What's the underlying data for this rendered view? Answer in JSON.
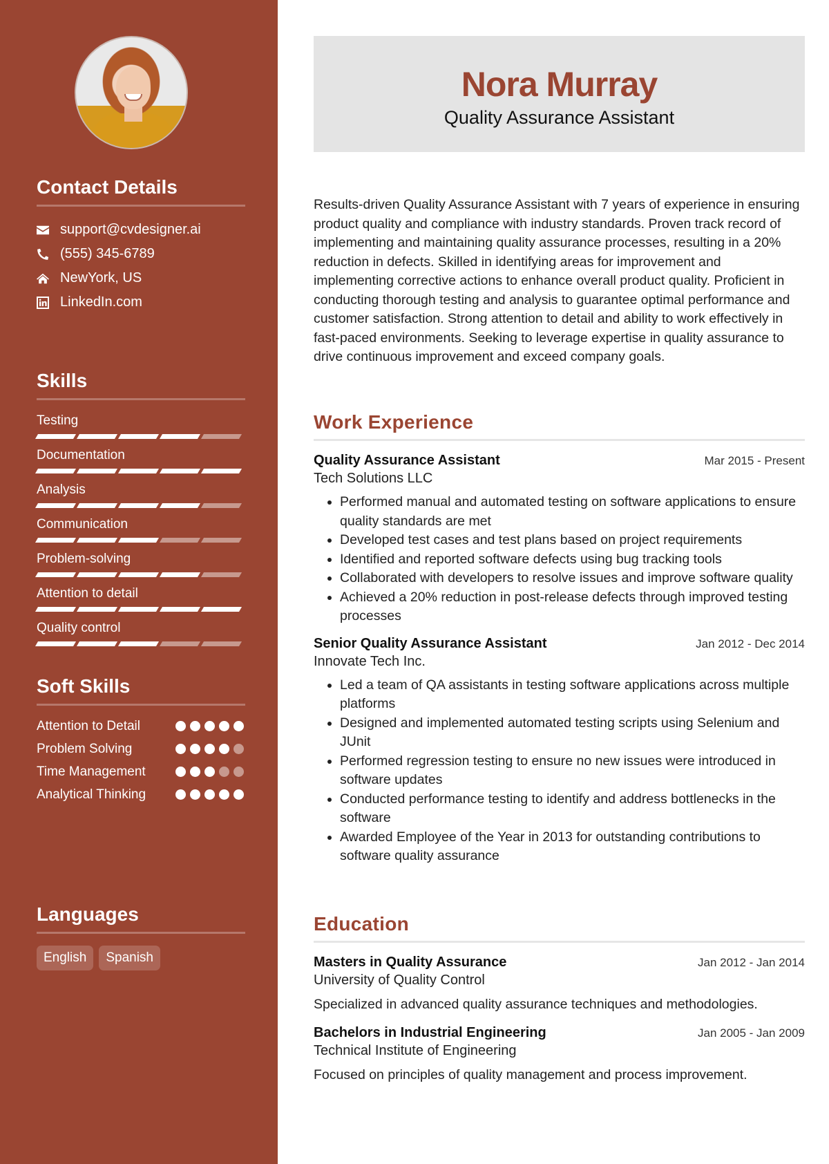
{
  "profile": {
    "name": "Nora Murray",
    "title": "Quality Assurance Assistant",
    "photo_alt": "profile photo"
  },
  "colors": {
    "accent": "#9a4532",
    "header_bg": "#e4e4e4"
  },
  "contact": {
    "heading": "Contact Details",
    "items": [
      {
        "icon": "envelope-icon",
        "text": "support@cvdesigner.ai"
      },
      {
        "icon": "phone-icon",
        "text": "(555) 345-6789"
      },
      {
        "icon": "home-icon",
        "text": "NewYork, US"
      },
      {
        "icon": "linkedin-icon",
        "text": "LinkedIn.com"
      }
    ]
  },
  "skills": {
    "heading": "Skills",
    "max": 5,
    "items": [
      {
        "label": "Testing",
        "level": 4
      },
      {
        "label": "Documentation",
        "level": 5
      },
      {
        "label": "Analysis",
        "level": 4
      },
      {
        "label": "Communication",
        "level": 3
      },
      {
        "label": "Problem-solving",
        "level": 4
      },
      {
        "label": "Attention to detail",
        "level": 5
      },
      {
        "label": "Quality control",
        "level": 3
      }
    ]
  },
  "soft_skills": {
    "heading": "Soft Skills",
    "max": 5,
    "items": [
      {
        "label": "Attention to Detail",
        "level": 5
      },
      {
        "label": "Problem Solving",
        "level": 4
      },
      {
        "label": "Time Management",
        "level": 3
      },
      {
        "label": "Analytical Thinking",
        "level": 5
      }
    ]
  },
  "languages": {
    "heading": "Languages",
    "items": [
      "English",
      "Spanish"
    ]
  },
  "summary": "Results-driven Quality Assurance Assistant with 7 years of experience in ensuring product quality and compliance with industry standards. Proven track record of implementing and maintaining quality assurance processes, resulting in a 20% reduction in defects. Skilled in identifying areas for improvement and implementing corrective actions to enhance overall product quality. Proficient in conducting thorough testing and analysis to guarantee optimal performance and customer satisfaction. Strong attention to detail and ability to work effectively in fast-paced environments. Seeking to leverage expertise in quality assurance to drive continuous improvement and exceed company goals.",
  "work": {
    "heading": "Work Experience",
    "jobs": [
      {
        "title": "Quality Assurance Assistant",
        "company": "Tech Solutions LLC",
        "dates": "Mar 2015 - Present",
        "bullets": [
          "Performed manual and automated testing on software applications to ensure quality standards are met",
          "Developed test cases and test plans based on project requirements",
          "Identified and reported software defects using bug tracking tools",
          "Collaborated with developers to resolve issues and improve software quality",
          "Achieved a 20% reduction in post-release defects through improved testing processes"
        ]
      },
      {
        "title": "Senior Quality Assurance Assistant",
        "company": "Innovate Tech Inc.",
        "dates": "Jan 2012 - Dec 2014",
        "bullets": [
          "Led a team of QA assistants in testing software applications across multiple platforms",
          "Designed and implemented automated testing scripts using Selenium and JUnit",
          "Performed regression testing to ensure no new issues were introduced in software updates",
          "Conducted performance testing to identify and address bottlenecks in the software",
          "Awarded Employee of the Year in 2013 for outstanding contributions to software quality assurance"
        ]
      }
    ]
  },
  "education": {
    "heading": "Education",
    "items": [
      {
        "degree": "Masters in Quality Assurance",
        "school": "University of Quality Control",
        "dates": "Jan 2012 - Jan 2014",
        "description": "Specialized in advanced quality assurance techniques and methodologies."
      },
      {
        "degree": "Bachelors in Industrial Engineering",
        "school": "Technical Institute of Engineering",
        "dates": "Jan 2005 - Jan 2009",
        "description": "Focused on principles of quality management and process improvement."
      }
    ]
  }
}
